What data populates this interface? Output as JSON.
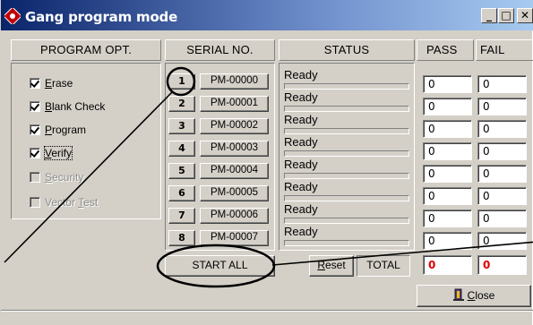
{
  "window": {
    "title": "Gang program mode",
    "min_glyph": "_",
    "max_glyph": "□",
    "close_glyph": "✕"
  },
  "headers": {
    "program_opt": "PROGRAM OPT.",
    "serial_no": "SERIAL NO.",
    "status": "STATUS",
    "pass": "PASS",
    "fail": "FAIL"
  },
  "options": [
    {
      "pre": "",
      "ul": "E",
      "post": "rase",
      "checked": true,
      "enabled": true
    },
    {
      "pre": "",
      "ul": "B",
      "post": "lank Check",
      "checked": true,
      "enabled": true
    },
    {
      "pre": "",
      "ul": "P",
      "post": "rogram",
      "checked": true,
      "enabled": true
    },
    {
      "pre": "",
      "ul": "V",
      "post": "erify",
      "checked": true,
      "enabled": true
    },
    {
      "pre": "",
      "ul": "S",
      "post": "ecurity",
      "checked": false,
      "enabled": false
    },
    {
      "pre": "Vector ",
      "ul": "T",
      "post": "est",
      "checked": false,
      "enabled": false
    }
  ],
  "sites": [
    {
      "num": "1",
      "serial": "PM-00000",
      "status": "Ready",
      "pass": "0",
      "fail": "0"
    },
    {
      "num": "2",
      "serial": "PM-00001",
      "status": "Ready",
      "pass": "0",
      "fail": "0"
    },
    {
      "num": "3",
      "serial": "PM-00002",
      "status": "Ready",
      "pass": "0",
      "fail": "0"
    },
    {
      "num": "4",
      "serial": "PM-00003",
      "status": "Ready",
      "pass": "0",
      "fail": "0"
    },
    {
      "num": "5",
      "serial": "PM-00004",
      "status": "Ready",
      "pass": "0",
      "fail": "0"
    },
    {
      "num": "6",
      "serial": "PM-00005",
      "status": "Ready",
      "pass": "0",
      "fail": "0"
    },
    {
      "num": "7",
      "serial": "PM-00006",
      "status": "Ready",
      "pass": "0",
      "fail": "0"
    },
    {
      "num": "8",
      "serial": "PM-00007",
      "status": "Ready",
      "pass": "0",
      "fail": "0"
    }
  ],
  "controls": {
    "start_all": "START ALL",
    "reset_ul": "R",
    "reset_rest": "eset",
    "total_label": "TOTAL",
    "total_pass": "0",
    "total_fail": "0",
    "close_ul": "C",
    "close_rest": "lose"
  },
  "colors": {
    "titlebar_start": "#0a246a",
    "titlebar_end": "#a6caf0",
    "face": "#d4d0c8",
    "total_text": "#e00000"
  }
}
